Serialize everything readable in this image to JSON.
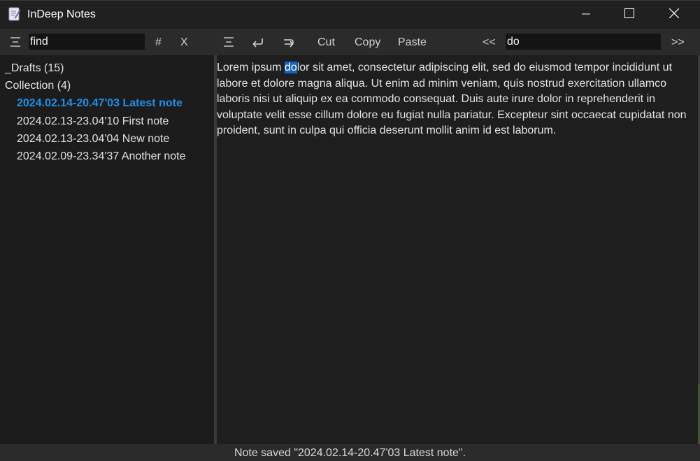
{
  "window": {
    "title": "InDeep Notes",
    "icon": "notepad-icon",
    "controls": [
      "minimize-icon",
      "maximize-icon",
      "close-icon"
    ]
  },
  "toolbar": {
    "left_menu_icon": "hamburger-icon",
    "search_value": "find",
    "tag_label": "#",
    "clear_label": "X",
    "right_menu_icon": "hamburger-icon",
    "undo_icon": "undo-icon",
    "redo_icon": "redo-icon",
    "cut_label": "Cut",
    "copy_label": "Copy",
    "paste_label": "Paste",
    "prev_label": "<<",
    "find_value": "do",
    "next_label": ">>"
  },
  "sidebar": {
    "items": [
      {
        "label": "_Drafts (15)"
      },
      {
        "label": "Collection (4)"
      },
      {
        "label": "2024.02.14-20.47'03 Latest note",
        "selected": true
      },
      {
        "label": "2024.02.13-23.04'10 First note"
      },
      {
        "label": "2024.02.13-23.04'04 New note"
      },
      {
        "label": "2024.02.09-23.34'37 Another note"
      }
    ]
  },
  "editor": {
    "text_before": "Lorem ipsum ",
    "highlight": "do",
    "text_after": "lor sit amet, consectetur adipiscing elit, sed do eiusmod tempor incididunt ut labore et dolore magna aliqua. Ut enim ad minim veniam, quis nostrud exercitation ullamco laboris nisi ut aliquip ex ea commodo consequat. Duis aute irure dolor in reprehenderit in voluptate velit esse cillum dolore eu fugiat nulla pariatur. Excepteur sint occaecat cupidatat non proident, sunt in culpa qui officia deserunt mollit anim id est laborum."
  },
  "status": {
    "message": "Note saved \"2024.02.14-20.47'03 Latest note\"."
  },
  "colors": {
    "accent": "#1e90e8",
    "highlight": "#1565c0",
    "background": "#202020"
  }
}
